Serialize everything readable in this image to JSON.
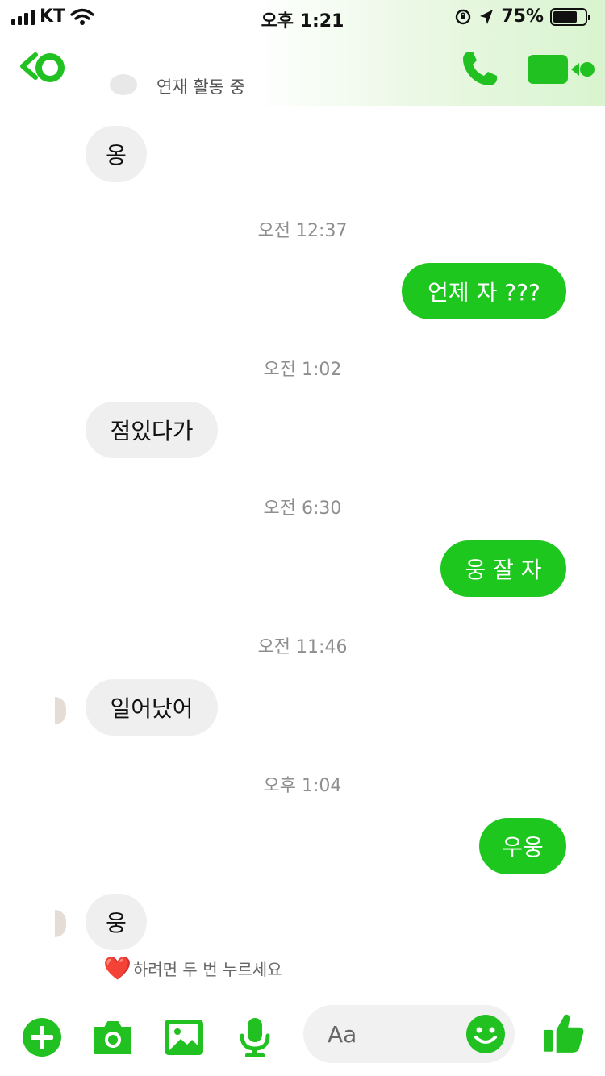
{
  "status_bar": {
    "carrier": "KT",
    "time": "오후 1:21",
    "battery_percent": "75%",
    "battery_level": 0.75,
    "icons": [
      "signal-icon",
      "wifi-icon",
      "orientation-lock-icon",
      "location-arrow-icon",
      "battery-icon"
    ]
  },
  "header": {
    "active_status": "연재 활동 중",
    "icons": [
      "back-icon",
      "phone-icon",
      "video-icon"
    ]
  },
  "messages": [
    {
      "type": "in",
      "text": "옹"
    },
    {
      "type": "time",
      "text": "오전 12:37"
    },
    {
      "type": "out",
      "text": "언제 자 ???"
    },
    {
      "type": "time",
      "text": "오전 1:02"
    },
    {
      "type": "in",
      "text": "점있다가"
    },
    {
      "type": "time",
      "text": "오전 6:30"
    },
    {
      "type": "out",
      "text": "웅 잘 자"
    },
    {
      "type": "time",
      "text": "오전 11:46"
    },
    {
      "type": "in",
      "text": "일어났어"
    },
    {
      "type": "time",
      "text": "오후 1:04"
    },
    {
      "type": "out",
      "text": "우웅"
    },
    {
      "type": "in",
      "text": "웅"
    }
  ],
  "reaction_hint": {
    "emoji": "❤️",
    "text": "하려면 두 번 누르세요"
  },
  "composer": {
    "placeholder": "Aa",
    "icons": [
      "plus-icon",
      "camera-icon",
      "image-icon",
      "microphone-icon",
      "emoji-icon",
      "thumbs-up-icon"
    ]
  },
  "colors": {
    "accent": "#1ec71e",
    "incoming_bubble": "#efefef",
    "timestamp": "#8e8e8e"
  }
}
